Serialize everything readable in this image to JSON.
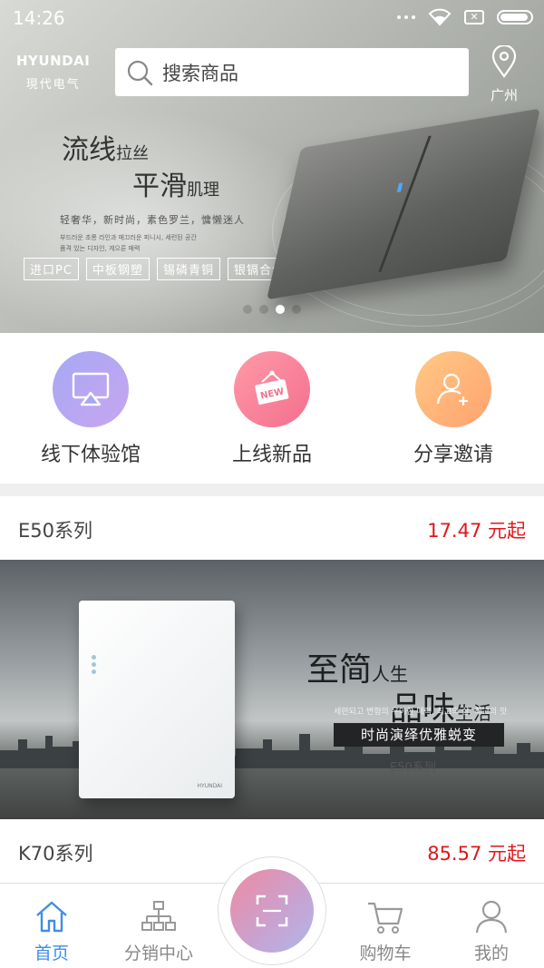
{
  "status_bar": {
    "time": "14:26"
  },
  "header": {
    "brand_en": "HYUNDAI",
    "brand_cn": "現代电气",
    "search_placeholder": "搜索商品",
    "location_city": "广州"
  },
  "banner": {
    "line1_big": "流线",
    "line1_small": "拉丝",
    "line2_big": "平滑",
    "line2_small": "肌理",
    "description": "轻奢华，新时尚，素色罗兰，慵懒迷人",
    "description_ko_1": "부드러운 초롱 라인과 매끄러운 피니시, 세련된 공간",
    "description_ko_2": "품격 있는 디자인, 게으른 매력",
    "tags": [
      "进口PC",
      "中板钢塑",
      "锡磷青铜",
      "银镉合金"
    ],
    "active_page": 3,
    "page_count": 4
  },
  "quick_actions": [
    {
      "label": "线下体验馆",
      "icon": "airplay-icon",
      "color_from": "#a7a8f4",
      "color_to": "#c7a6f0"
    },
    {
      "label": "上线新品",
      "icon": "new-sign-icon",
      "color_from": "#ff9aa8",
      "color_to": "#f46f8e"
    },
    {
      "label": "分享邀请",
      "icon": "add-user-icon",
      "color_from": "#ffc985",
      "color_to": "#ffa26f"
    }
  ],
  "products": [
    {
      "name": "E50系列",
      "price": "17.47 元起",
      "image": {
        "title_big": "至简",
        "title_small": "人生",
        "title2_big": "品味",
        "title2_small": "生活",
        "ko_text": "세련되고 변형의 우아한 매력, 최고의 삶, 최고의 맛",
        "bar_text": "时尚演绎优雅蜕变",
        "series_label": "E50系列",
        "panel_brand": "HYUNDAI"
      }
    },
    {
      "name": "K70系列",
      "price": "85.57 元起"
    }
  ],
  "tabbar": {
    "tabs": [
      {
        "label": "首页",
        "icon": "home-icon",
        "active": true
      },
      {
        "label": "分销中心",
        "icon": "org-chart-icon",
        "active": false
      },
      {
        "label": "购物车",
        "icon": "cart-icon",
        "active": false
      },
      {
        "label": "我的",
        "icon": "person-icon",
        "active": false
      }
    ],
    "center_icon": "scan-icon"
  },
  "colors": {
    "accent": "#3e8ee6",
    "price": "#e0161b"
  }
}
